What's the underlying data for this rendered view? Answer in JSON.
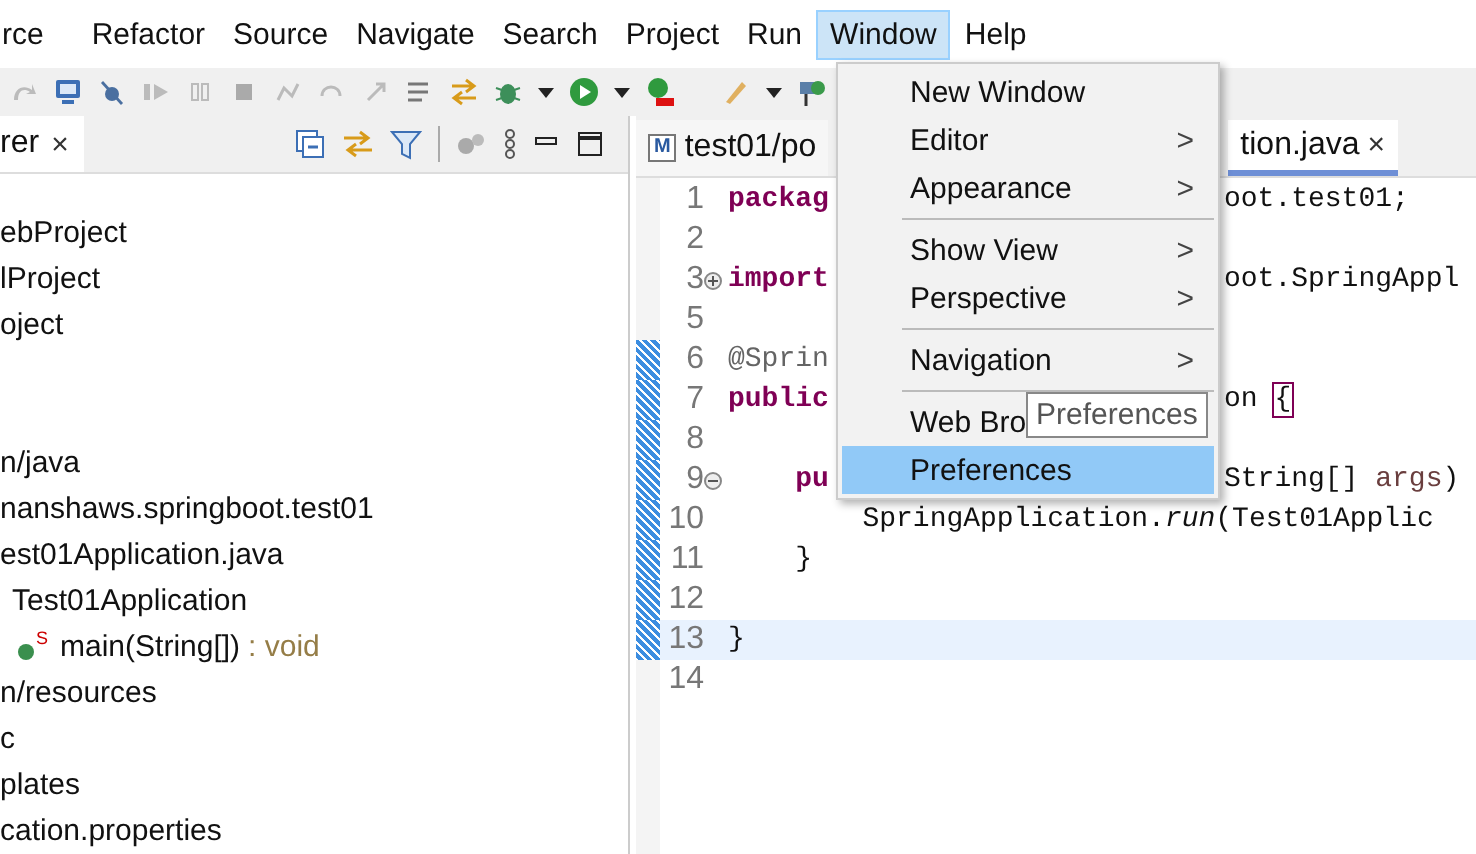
{
  "menu_bar": [
    {
      "label": "rce",
      "selected": false
    },
    {
      "label": "Refactor",
      "selected": false
    },
    {
      "label": "Source",
      "selected": false
    },
    {
      "label": "Navigate",
      "selected": false
    },
    {
      "label": "Search",
      "selected": false
    },
    {
      "label": "Project",
      "selected": false
    },
    {
      "label": "Run",
      "selected": false
    },
    {
      "label": "Window",
      "selected": true
    },
    {
      "label": "Help",
      "selected": false
    }
  ],
  "explorer": {
    "tab": {
      "label": "rer",
      "close": "×"
    },
    "sections": [
      {
        "items": [
          {
            "text": "ebProject",
            "kind": "plain"
          },
          {
            "text": "lProject",
            "kind": "plain"
          },
          {
            "text": "oject",
            "kind": "plain"
          }
        ]
      },
      {
        "items": [
          {
            "text": "n/java",
            "kind": "plain"
          },
          {
            "text": "nanshaws.springboot.test01",
            "kind": "plain"
          },
          {
            "text": "est01Application.java",
            "kind": "plain"
          },
          {
            "text": "Test01Application",
            "kind": "class"
          },
          {
            "text": "main(String[])",
            "suffix": ": void",
            "kind": "method",
            "badge": "S"
          },
          {
            "text": "n/resources",
            "kind": "plain"
          },
          {
            "text": "c",
            "kind": "plain"
          },
          {
            "text": "plates",
            "kind": "plain"
          },
          {
            "text": "cation.properties",
            "kind": "plain"
          }
        ]
      }
    ]
  },
  "editor": {
    "tabs": [
      {
        "label": "test01/po",
        "selected": false,
        "icon_letter": "M"
      },
      {
        "label": "tion.java",
        "selected": true,
        "close": "×"
      }
    ],
    "lines": [
      {
        "number": "1",
        "marker": false,
        "current": false,
        "left": [
          {
            "text": "packag",
            "kind": "keyword"
          }
        ],
        "right": [
          {
            "text": "oot.test01;",
            "kind": "plain"
          }
        ]
      },
      {
        "number": "2",
        "marker": false,
        "current": false
      },
      {
        "number": "3",
        "marker": false,
        "current": false,
        "fold": {
          "collapsed": true
        },
        "left": [
          {
            "text": "import",
            "kind": "keyword"
          }
        ],
        "right": [
          {
            "text": "oot.SpringAppl",
            "kind": "plain"
          }
        ]
      },
      {
        "number": "5",
        "marker": false,
        "current": false
      },
      {
        "number": "6",
        "marker": true,
        "current": false,
        "left": [
          {
            "text": "@Sprin",
            "kind": "annotation"
          }
        ]
      },
      {
        "number": "7",
        "marker": true,
        "current": false,
        "left": [
          {
            "text": "public",
            "kind": "keyword"
          }
        ],
        "right": [
          {
            "text": "on ",
            "kind": "plain"
          },
          {
            "text": "{",
            "kind": "bracket"
          }
        ]
      },
      {
        "number": "8",
        "marker": true,
        "current": false
      },
      {
        "number": "9",
        "marker": true,
        "current": false,
        "fold": {
          "collapsed": false
        },
        "left": [
          {
            "text": "    pu",
            "kind": "keyword"
          }
        ],
        "right": [
          {
            "text": "String[] ",
            "kind": "plain"
          },
          {
            "text": "args",
            "kind": "param"
          },
          {
            "text": ")",
            "kind": "plain"
          }
        ]
      },
      {
        "number": "10",
        "marker": true,
        "current": false,
        "left": [
          {
            "text": "        SpringApplication.*run*(Test01Applic",
            "kind": "plain"
          }
        ]
      },
      {
        "number": "11",
        "marker": true,
        "current": false,
        "left": [
          {
            "text": "    }",
            "kind": "plain"
          }
        ]
      },
      {
        "number": "12",
        "marker": true,
        "current": false
      },
      {
        "number": "13",
        "marker": true,
        "current": true,
        "left": [
          {
            "text": "}",
            "kind": "plain"
          }
        ]
      },
      {
        "number": "14",
        "marker": false,
        "current": false
      }
    ]
  },
  "window_menu": {
    "items": [
      {
        "label": "New Window",
        "submenu": false,
        "separator_before": false,
        "selected": false
      },
      {
        "label": "Editor",
        "submenu": true,
        "separator_before": false,
        "selected": false
      },
      {
        "label": "Appearance",
        "submenu": true,
        "separator_before": false,
        "selected": false
      },
      {
        "label": "Show View",
        "submenu": true,
        "separator_before": true,
        "selected": false
      },
      {
        "label": "Perspective",
        "submenu": true,
        "separator_before": false,
        "selected": false
      },
      {
        "label": "Navigation",
        "submenu": true,
        "separator_before": true,
        "selected": false
      },
      {
        "label": "Web Bro",
        "submenu": false,
        "separator_before": true,
        "selected": false
      },
      {
        "label": "Preferences",
        "submenu": false,
        "separator_before": false,
        "selected": true
      }
    ],
    "submenu_arrow": ">"
  },
  "tooltip": {
    "text": "Preferences"
  }
}
